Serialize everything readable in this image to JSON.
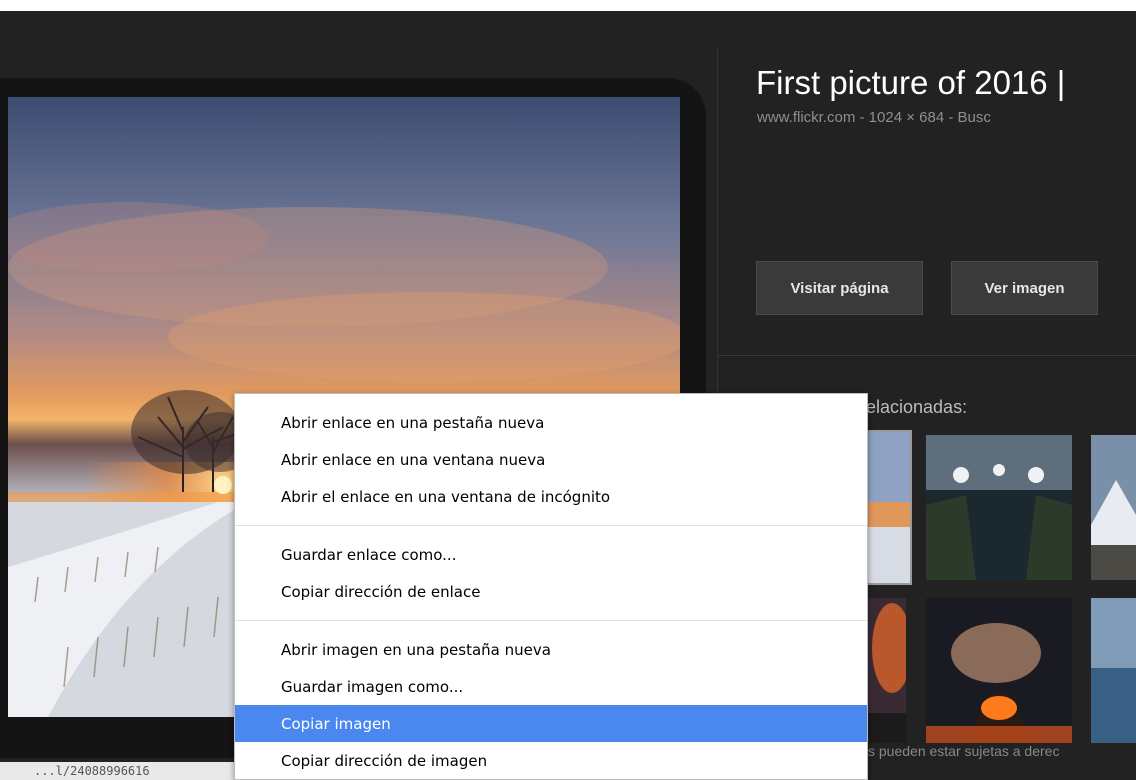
{
  "details": {
    "title": "First picture of 2016 |",
    "meta": "www.flickr.com  - 1024 × 684 - Busc",
    "visit_button": "Visitar página",
    "view_button": "Ver imagen"
  },
  "related": {
    "label": "relacionadas:",
    "footer": "s pueden estar sujetas a derec"
  },
  "status": {
    "url_fragment": "...l/24088996616"
  },
  "context_menu": {
    "group1": [
      "Abrir enlace en una pestaña nueva",
      "Abrir enlace en una ventana nueva",
      "Abrir el enlace en una ventana de incógnito"
    ],
    "group2": [
      "Guardar enlace como...",
      "Copiar dirección de enlace"
    ],
    "group3": [
      "Abrir imagen en una pestaña nueva",
      "Guardar imagen como...",
      "Copiar imagen",
      "Copiar dirección de imagen"
    ],
    "highlighted": "Copiar imagen"
  },
  "colors": {
    "background": "#222222",
    "button_bg": "#3a3a3a",
    "menu_highlight": "#4a88f0"
  }
}
